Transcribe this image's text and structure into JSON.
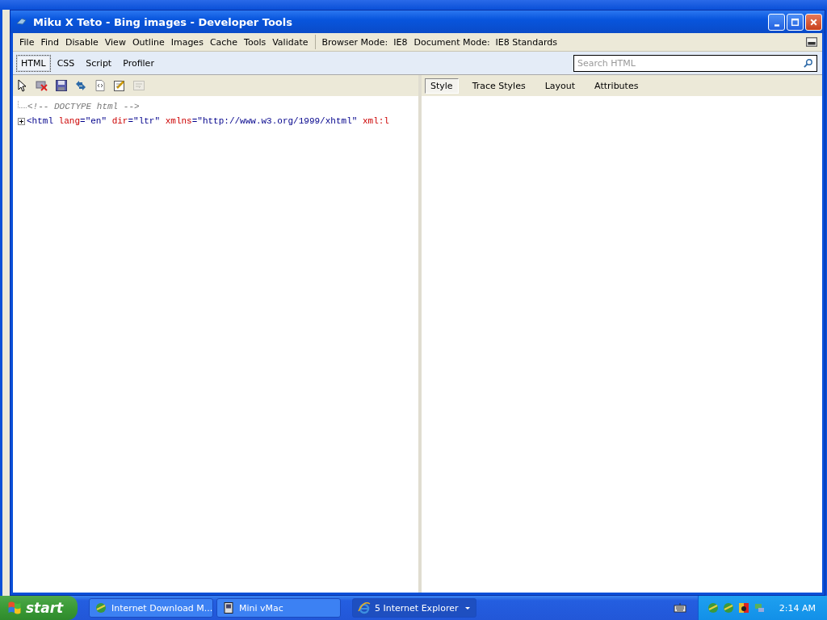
{
  "window": {
    "title": "Miku X Teto - Bing images - Developer Tools"
  },
  "menu": [
    "File",
    "Find",
    "Disable",
    "View",
    "Outline",
    "Images",
    "Cache",
    "Tools",
    "Validate"
  ],
  "modes": [
    "Browser Mode:  IE8",
    "Document Mode:  IE8 Standards"
  ],
  "tabs": [
    {
      "label": "HTML",
      "selected": true
    },
    {
      "label": "CSS",
      "selected": false
    },
    {
      "label": "Script",
      "selected": false
    },
    {
      "label": "Profiler",
      "selected": false
    }
  ],
  "search": {
    "placeholder": "Search HTML"
  },
  "toolbar": [
    {
      "kind": "select",
      "disabled": false
    },
    {
      "kind": "clear",
      "disabled": false
    },
    {
      "kind": "save",
      "disabled": false
    },
    {
      "kind": "refresh",
      "disabled": false
    },
    {
      "kind": "source",
      "disabled": false
    },
    {
      "kind": "edit",
      "disabled": false
    },
    {
      "kind": "wordwrap",
      "disabled": true
    }
  ],
  "side_tabs": [
    {
      "label": "Style",
      "selected": true
    },
    {
      "label": "Trace Styles",
      "selected": false
    },
    {
      "label": "Layout",
      "selected": false
    },
    {
      "label": "Attributes",
      "selected": false
    }
  ],
  "tree": [
    {
      "expandable": false,
      "tokens": [
        {
          "kind": "comment",
          "text": "<!-- DOCTYPE html -->"
        }
      ]
    },
    {
      "expandable": true,
      "tokens": [
        {
          "kind": "tag",
          "text": "<html"
        },
        {
          "kind": "attr",
          "text": " lang"
        },
        {
          "kind": "tag",
          "text": "="
        },
        {
          "kind": "value",
          "text": "\"en\""
        },
        {
          "kind": "attr",
          "text": " dir"
        },
        {
          "kind": "tag",
          "text": "="
        },
        {
          "kind": "value",
          "text": "\"ltr\""
        },
        {
          "kind": "attr",
          "text": " xmlns"
        },
        {
          "kind": "tag",
          "text": "="
        },
        {
          "kind": "value",
          "text": "\"http://www.w3.org/1999/xhtml\""
        },
        {
          "kind": "attr",
          "text": " xml:l"
        }
      ]
    }
  ],
  "taskbar": {
    "start": "start",
    "tasks": [
      {
        "label": "Internet Download M...",
        "kind": "idm",
        "selected": false
      },
      {
        "label": "Mini vMac",
        "kind": "mac",
        "selected": false
      },
      {
        "label": "5 Internet Explorer",
        "kind": "ie",
        "selected": true
      }
    ],
    "clock": "2:14 AM"
  }
}
